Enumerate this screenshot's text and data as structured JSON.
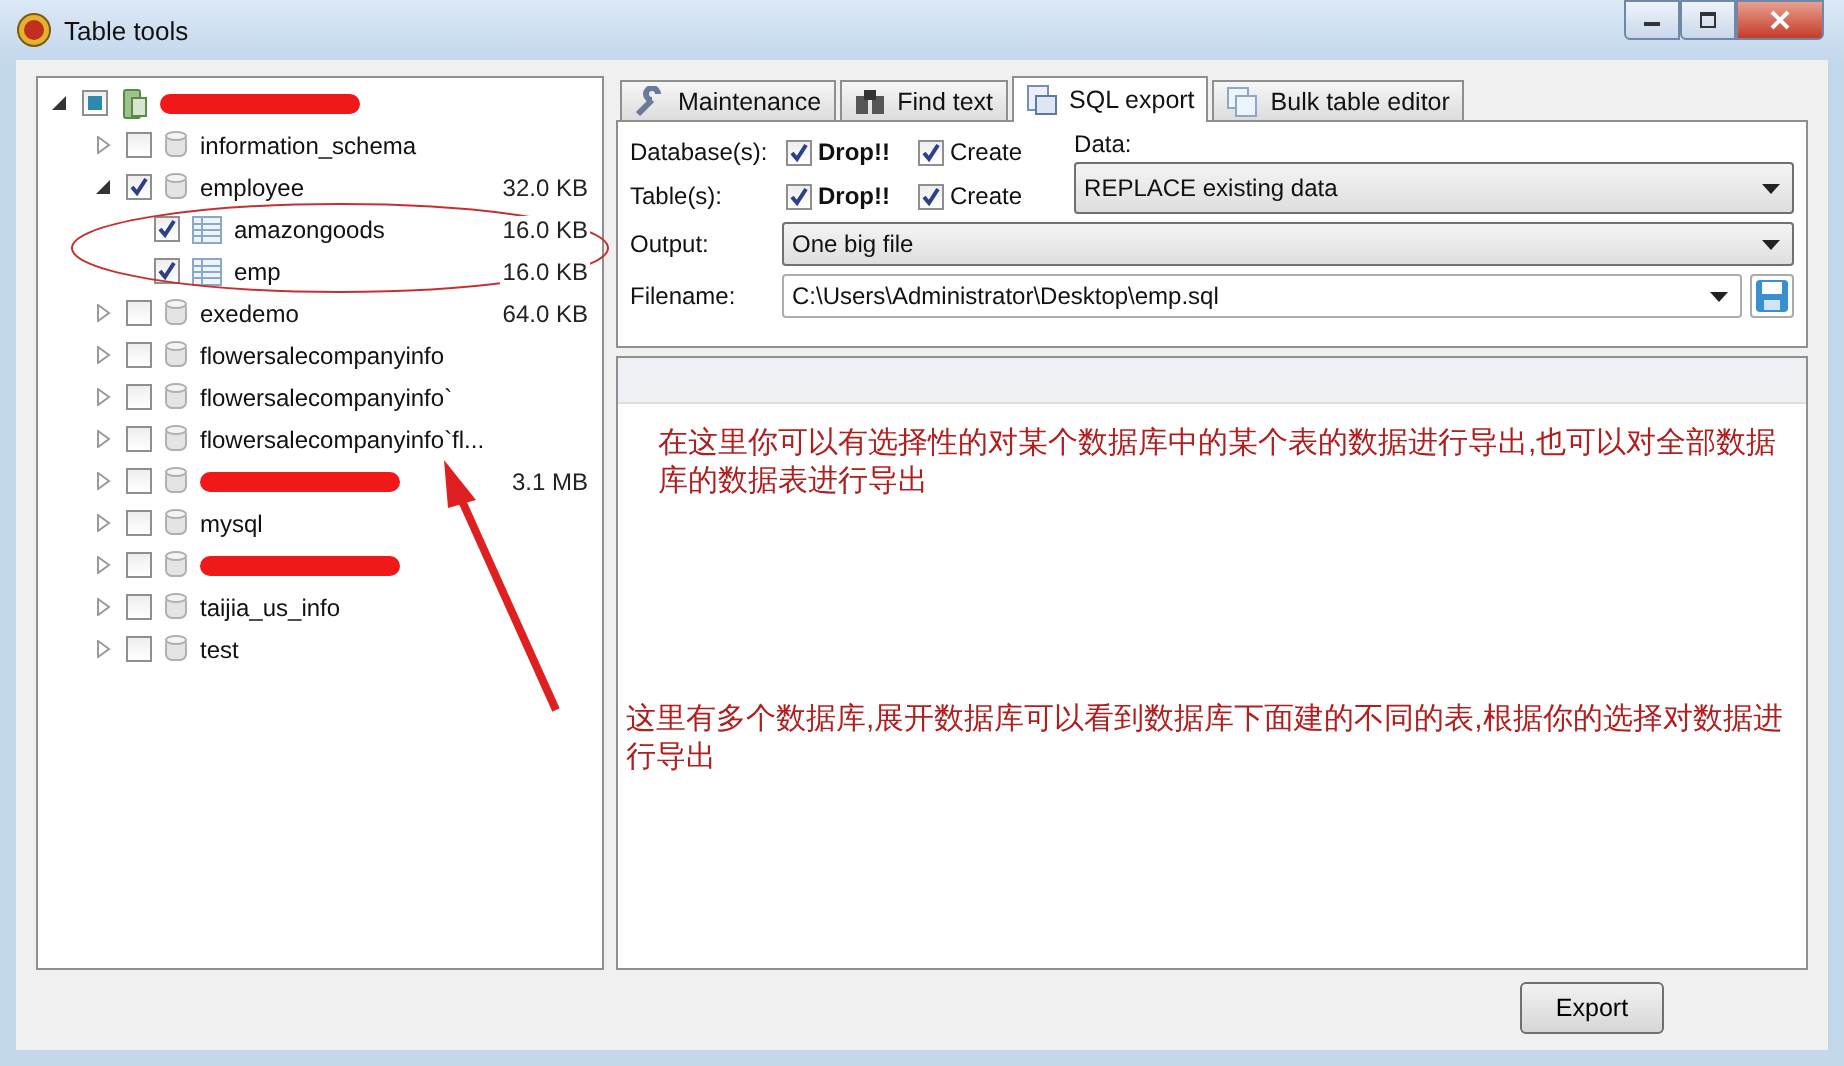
{
  "window": {
    "title": "Table tools"
  },
  "tree": [
    {
      "kind": "server",
      "redacted": true,
      "expanded": true,
      "checked": false,
      "mixed": true,
      "children": [
        {
          "kind": "database",
          "name": "information_schema",
          "expanded": false,
          "checked": false
        },
        {
          "kind": "database",
          "name": "employee",
          "size": "32.0 KB",
          "expanded": true,
          "checked": true,
          "children": [
            {
              "kind": "table",
              "name": "amazongoods",
              "size": "16.0 KB",
              "checked": true
            },
            {
              "kind": "table",
              "name": "emp",
              "size": "16.0 KB",
              "checked": true
            }
          ]
        },
        {
          "kind": "database",
          "name": "exedemo",
          "size": "64.0 KB",
          "expanded": false,
          "checked": false
        },
        {
          "kind": "database",
          "name": "flowersalecompanyinfo",
          "expanded": false,
          "checked": false
        },
        {
          "kind": "database",
          "name": "flowersalecompanyinfo`",
          "expanded": false,
          "checked": false
        },
        {
          "kind": "database",
          "name": "flowersalecompanyinfo`fl...",
          "expanded": false,
          "checked": false
        },
        {
          "kind": "database",
          "redacted": true,
          "size": "3.1 MB",
          "expanded": false,
          "checked": false
        },
        {
          "kind": "database",
          "name": "mysql",
          "expanded": false,
          "checked": false
        },
        {
          "kind": "database",
          "redacted": true,
          "expanded": false,
          "checked": false
        },
        {
          "kind": "database",
          "name": "taijia_us_info",
          "expanded": false,
          "checked": false
        },
        {
          "kind": "database",
          "name": "test",
          "expanded": false,
          "checked": false
        }
      ]
    }
  ],
  "tabs": [
    {
      "label": "Maintenance",
      "selected": false
    },
    {
      "label": "Find text",
      "selected": false
    },
    {
      "label": "SQL export",
      "selected": true
    },
    {
      "label": "Bulk table editor",
      "selected": false
    }
  ],
  "export": {
    "option_rows": [
      {
        "label": "Database(s):",
        "drop": {
          "label": "Drop!!",
          "checked": true
        },
        "create": {
          "label": "Create",
          "checked": true
        }
      },
      {
        "label": "Table(s):",
        "drop": {
          "label": "Drop!!",
          "checked": true
        },
        "create": {
          "label": "Create",
          "checked": true
        }
      }
    ],
    "data": {
      "label": "Data:",
      "value": "REPLACE existing data"
    },
    "output": {
      "label": "Output:",
      "value": "One big file"
    },
    "filename": {
      "label": "Filename:",
      "value": "C:\\Users\\Administrator\\Desktop\\emp.sql"
    }
  },
  "notes": [
    "在这里你可以有选择性的对某个数据库中的某个表的数据进行导出,也可以对全部数据库的数据表进行导出",
    "这里有多个数据库,展开数据库可以看到数据库下面建的不同的表,根据你的选择对数据进行导出"
  ],
  "buttons": [
    {
      "label": "Export"
    }
  ]
}
